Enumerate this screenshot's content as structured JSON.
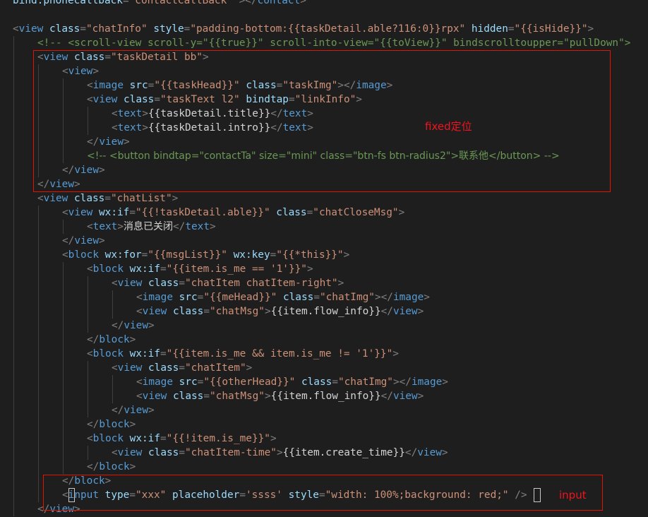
{
  "editor": {
    "language": "wxml",
    "lines": [
      {
        "indent": 0,
        "tokens": [
          [
            "attr",
            "bind:phonecallback"
          ],
          [
            "punc",
            "="
          ],
          [
            "str",
            "\"contactCallBack\""
          ],
          [
            "text",
            " "
          ],
          [
            "punc",
            "></"
          ],
          [
            "tag",
            "contact"
          ],
          [
            "punc",
            ">"
          ]
        ]
      },
      {
        "indent": 0,
        "tokens": []
      },
      {
        "indent": 0,
        "tokens": [
          [
            "punc",
            "<"
          ],
          [
            "tag",
            "view"
          ],
          [
            "text",
            " "
          ],
          [
            "attr",
            "class"
          ],
          [
            "punc",
            "="
          ],
          [
            "str",
            "\"chatInfo\""
          ],
          [
            "text",
            " "
          ],
          [
            "attr",
            "style"
          ],
          [
            "punc",
            "="
          ],
          [
            "str",
            "\"padding-bottom:{{taskDetail.able?116:0}}rpx\""
          ],
          [
            "text",
            " "
          ],
          [
            "attr",
            "hidden"
          ],
          [
            "punc",
            "="
          ],
          [
            "str",
            "\"{{isHide}}\""
          ],
          [
            "punc",
            ">"
          ]
        ]
      },
      {
        "indent": 1,
        "tokens": [
          [
            "comment",
            "<!-- <scroll-view scroll-y=\"{{true}}\" scroll-into-view=\"{{toView}}\" bindscrolltoupper=\"pullDown\">"
          ]
        ]
      },
      {
        "indent": 1,
        "tokens": [
          [
            "punc",
            "<"
          ],
          [
            "tag",
            "view"
          ],
          [
            "text",
            " "
          ],
          [
            "attr",
            "class"
          ],
          [
            "punc",
            "="
          ],
          [
            "str",
            "\"taskDetail bb\""
          ],
          [
            "punc",
            ">"
          ]
        ]
      },
      {
        "indent": 2,
        "tokens": [
          [
            "punc",
            "<"
          ],
          [
            "tag",
            "view"
          ],
          [
            "punc",
            ">"
          ]
        ]
      },
      {
        "indent": 3,
        "tokens": [
          [
            "punc",
            "<"
          ],
          [
            "tag",
            "image"
          ],
          [
            "text",
            " "
          ],
          [
            "attr",
            "src"
          ],
          [
            "punc",
            "="
          ],
          [
            "str",
            "\"{{taskHead}}\""
          ],
          [
            "text",
            " "
          ],
          [
            "attr",
            "class"
          ],
          [
            "punc",
            "="
          ],
          [
            "str",
            "\"taskImg\""
          ],
          [
            "punc",
            "></"
          ],
          [
            "tag",
            "image"
          ],
          [
            "punc",
            ">"
          ]
        ]
      },
      {
        "indent": 3,
        "tokens": [
          [
            "punc",
            "<"
          ],
          [
            "tag",
            "view"
          ],
          [
            "text",
            " "
          ],
          [
            "attr",
            "class"
          ],
          [
            "punc",
            "="
          ],
          [
            "str",
            "\"taskText l2\""
          ],
          [
            "text",
            " "
          ],
          [
            "attr",
            "bindtap"
          ],
          [
            "punc",
            "="
          ],
          [
            "str",
            "\"linkInfo\""
          ],
          [
            "punc",
            ">"
          ]
        ]
      },
      {
        "indent": 4,
        "tokens": [
          [
            "punc",
            "<"
          ],
          [
            "tag",
            "text"
          ],
          [
            "punc",
            ">"
          ],
          [
            "text",
            "{{taskDetail.title}}"
          ],
          [
            "punc",
            "</"
          ],
          [
            "tag",
            "text"
          ],
          [
            "punc",
            ">"
          ]
        ]
      },
      {
        "indent": 4,
        "tokens": [
          [
            "punc",
            "<"
          ],
          [
            "tag",
            "text"
          ],
          [
            "punc",
            ">"
          ],
          [
            "text",
            "{{taskDetail.intro}}"
          ],
          [
            "punc",
            "</"
          ],
          [
            "tag",
            "text"
          ],
          [
            "punc",
            ">"
          ]
        ]
      },
      {
        "indent": 3,
        "tokens": [
          [
            "punc",
            "</"
          ],
          [
            "tag",
            "view"
          ],
          [
            "punc",
            ">"
          ]
        ]
      },
      {
        "indent": 3,
        "tokens": [
          [
            "comment",
            "<!-- <button bindtap=\"contactTa\" size=\"mini\" class=\"btn-fs btn-radius2\">联系他</button> -->"
          ]
        ]
      },
      {
        "indent": 2,
        "tokens": [
          [
            "punc",
            "</"
          ],
          [
            "tag",
            "view"
          ],
          [
            "punc",
            ">"
          ]
        ]
      },
      {
        "indent": 1,
        "tokens": [
          [
            "punc",
            "</"
          ],
          [
            "tag",
            "view"
          ],
          [
            "punc",
            ">"
          ]
        ]
      },
      {
        "indent": 1,
        "tokens": [
          [
            "punc",
            "<"
          ],
          [
            "tag",
            "view"
          ],
          [
            "text",
            " "
          ],
          [
            "attr",
            "class"
          ],
          [
            "punc",
            "="
          ],
          [
            "str",
            "\"chatList\""
          ],
          [
            "punc",
            ">"
          ]
        ]
      },
      {
        "indent": 2,
        "tokens": [
          [
            "punc",
            "<"
          ],
          [
            "tag",
            "view"
          ],
          [
            "text",
            " "
          ],
          [
            "attr",
            "wx:if"
          ],
          [
            "punc",
            "="
          ],
          [
            "str",
            "\"{{!taskDetail.able}}\""
          ],
          [
            "text",
            " "
          ],
          [
            "attr",
            "class"
          ],
          [
            "punc",
            "="
          ],
          [
            "str",
            "\"chatCloseMsg\""
          ],
          [
            "punc",
            ">"
          ]
        ]
      },
      {
        "indent": 3,
        "tokens": [
          [
            "punc",
            "<"
          ],
          [
            "tag",
            "text"
          ],
          [
            "punc",
            ">"
          ],
          [
            "text",
            "消息已关闭"
          ],
          [
            "punc",
            "</"
          ],
          [
            "tag",
            "text"
          ],
          [
            "punc",
            ">"
          ]
        ]
      },
      {
        "indent": 2,
        "tokens": [
          [
            "punc",
            "</"
          ],
          [
            "tag",
            "view"
          ],
          [
            "punc",
            ">"
          ]
        ]
      },
      {
        "indent": 2,
        "tokens": [
          [
            "punc",
            "<"
          ],
          [
            "tag",
            "block"
          ],
          [
            "text",
            " "
          ],
          [
            "attr",
            "wx:for"
          ],
          [
            "punc",
            "="
          ],
          [
            "str",
            "\"{{msgList}}\""
          ],
          [
            "text",
            " "
          ],
          [
            "attr",
            "wx:key"
          ],
          [
            "punc",
            "="
          ],
          [
            "str",
            "\"{{*this}}\""
          ],
          [
            "punc",
            ">"
          ]
        ]
      },
      {
        "indent": 3,
        "tokens": [
          [
            "punc",
            "<"
          ],
          [
            "tag",
            "block"
          ],
          [
            "text",
            " "
          ],
          [
            "attr",
            "wx:if"
          ],
          [
            "punc",
            "="
          ],
          [
            "str",
            "\"{{item.is_me == '1'}}\""
          ],
          [
            "punc",
            ">"
          ]
        ]
      },
      {
        "indent": 4,
        "tokens": [
          [
            "punc",
            "<"
          ],
          [
            "tag",
            "view"
          ],
          [
            "text",
            " "
          ],
          [
            "attr",
            "class"
          ],
          [
            "punc",
            "="
          ],
          [
            "str",
            "\"chatItem chatItem-right\""
          ],
          [
            "punc",
            ">"
          ]
        ]
      },
      {
        "indent": 5,
        "tokens": [
          [
            "punc",
            "<"
          ],
          [
            "tag",
            "image"
          ],
          [
            "text",
            " "
          ],
          [
            "attr",
            "src"
          ],
          [
            "punc",
            "="
          ],
          [
            "str",
            "\"{{meHead}}\""
          ],
          [
            "text",
            " "
          ],
          [
            "attr",
            "class"
          ],
          [
            "punc",
            "="
          ],
          [
            "str",
            "\"chatImg\""
          ],
          [
            "punc",
            "></"
          ],
          [
            "tag",
            "image"
          ],
          [
            "punc",
            ">"
          ]
        ]
      },
      {
        "indent": 5,
        "tokens": [
          [
            "punc",
            "<"
          ],
          [
            "tag",
            "view"
          ],
          [
            "text",
            " "
          ],
          [
            "attr",
            "class"
          ],
          [
            "punc",
            "="
          ],
          [
            "str",
            "\"chatMsg\""
          ],
          [
            "punc",
            ">"
          ],
          [
            "text",
            "{{item.flow_info}}"
          ],
          [
            "punc",
            "</"
          ],
          [
            "tag",
            "view"
          ],
          [
            "punc",
            ">"
          ]
        ]
      },
      {
        "indent": 4,
        "tokens": [
          [
            "punc",
            "</"
          ],
          [
            "tag",
            "view"
          ],
          [
            "punc",
            ">"
          ]
        ]
      },
      {
        "indent": 3,
        "tokens": [
          [
            "punc",
            "</"
          ],
          [
            "tag",
            "block"
          ],
          [
            "punc",
            ">"
          ]
        ]
      },
      {
        "indent": 3,
        "tokens": [
          [
            "punc",
            "<"
          ],
          [
            "tag",
            "block"
          ],
          [
            "text",
            " "
          ],
          [
            "attr",
            "wx:if"
          ],
          [
            "punc",
            "="
          ],
          [
            "str",
            "\"{{item.is_me && item.is_me != '1'}}\""
          ],
          [
            "punc",
            ">"
          ]
        ]
      },
      {
        "indent": 4,
        "tokens": [
          [
            "punc",
            "<"
          ],
          [
            "tag",
            "view"
          ],
          [
            "text",
            " "
          ],
          [
            "attr",
            "class"
          ],
          [
            "punc",
            "="
          ],
          [
            "str",
            "\"chatItem\""
          ],
          [
            "punc",
            ">"
          ]
        ]
      },
      {
        "indent": 5,
        "tokens": [
          [
            "punc",
            "<"
          ],
          [
            "tag",
            "image"
          ],
          [
            "text",
            " "
          ],
          [
            "attr",
            "src"
          ],
          [
            "punc",
            "="
          ],
          [
            "str",
            "\"{{otherHead}}\""
          ],
          [
            "text",
            " "
          ],
          [
            "attr",
            "class"
          ],
          [
            "punc",
            "="
          ],
          [
            "str",
            "\"chatImg\""
          ],
          [
            "punc",
            "></"
          ],
          [
            "tag",
            "image"
          ],
          [
            "punc",
            ">"
          ]
        ]
      },
      {
        "indent": 5,
        "tokens": [
          [
            "punc",
            "<"
          ],
          [
            "tag",
            "view"
          ],
          [
            "text",
            " "
          ],
          [
            "attr",
            "class"
          ],
          [
            "punc",
            "="
          ],
          [
            "str",
            "\"chatMsg\""
          ],
          [
            "punc",
            ">"
          ],
          [
            "text",
            "{{item.flow_info}}"
          ],
          [
            "punc",
            "</"
          ],
          [
            "tag",
            "view"
          ],
          [
            "punc",
            ">"
          ]
        ]
      },
      {
        "indent": 4,
        "tokens": [
          [
            "punc",
            "</"
          ],
          [
            "tag",
            "view"
          ],
          [
            "punc",
            ">"
          ]
        ]
      },
      {
        "indent": 3,
        "tokens": [
          [
            "punc",
            "</"
          ],
          [
            "tag",
            "block"
          ],
          [
            "punc",
            ">"
          ]
        ]
      },
      {
        "indent": 3,
        "tokens": [
          [
            "punc",
            "<"
          ],
          [
            "tag",
            "block"
          ],
          [
            "text",
            " "
          ],
          [
            "attr",
            "wx:if"
          ],
          [
            "punc",
            "="
          ],
          [
            "str",
            "\"{{!item.is_me}}\""
          ],
          [
            "punc",
            ">"
          ]
        ]
      },
      {
        "indent": 4,
        "tokens": [
          [
            "punc",
            "<"
          ],
          [
            "tag",
            "view"
          ],
          [
            "text",
            " "
          ],
          [
            "attr",
            "class"
          ],
          [
            "punc",
            "="
          ],
          [
            "str",
            "\"chatItem-time\""
          ],
          [
            "punc",
            ">"
          ],
          [
            "text",
            "{{item.create_time}}"
          ],
          [
            "punc",
            "</"
          ],
          [
            "tag",
            "view"
          ],
          [
            "punc",
            ">"
          ]
        ]
      },
      {
        "indent": 3,
        "tokens": [
          [
            "punc",
            "</"
          ],
          [
            "tag",
            "block"
          ],
          [
            "punc",
            ">"
          ]
        ]
      },
      {
        "indent": 2,
        "tokens": [
          [
            "punc",
            "</"
          ],
          [
            "tag",
            "block"
          ],
          [
            "punc",
            ">"
          ]
        ]
      },
      {
        "indent": 2,
        "tokens": [
          [
            "punc",
            "<"
          ],
          [
            "tag",
            "input"
          ],
          [
            "text",
            " "
          ],
          [
            "attr",
            "type"
          ],
          [
            "punc",
            "="
          ],
          [
            "str",
            "\"xxx\""
          ],
          [
            "text",
            " "
          ],
          [
            "attr",
            "placeholder"
          ],
          [
            "punc",
            "="
          ],
          [
            "str",
            "'ssss'"
          ],
          [
            "text",
            " "
          ],
          [
            "attr",
            "style"
          ],
          [
            "punc",
            "="
          ],
          [
            "str",
            "\"width: 100%;background: red;\""
          ],
          [
            "text",
            " "
          ],
          [
            "punc",
            "/>"
          ]
        ]
      },
      {
        "indent": 1,
        "tokens": [
          [
            "punc",
            "</"
          ],
          [
            "tag",
            "view"
          ],
          [
            "punc",
            ">"
          ]
        ]
      }
    ]
  },
  "annotations": [
    {
      "name": "fixed-annotation",
      "label": "fixed定位"
    },
    {
      "name": "input-annotation",
      "label": "input"
    }
  ],
  "colors": {
    "background": "#1e1e1e",
    "tag": "#569cd6",
    "attribute": "#9cdcfe",
    "string": "#ce9178",
    "punctuation": "#808080",
    "text": "#d4d4d4",
    "comment": "#6a9955",
    "annotation": "#e51400"
  }
}
